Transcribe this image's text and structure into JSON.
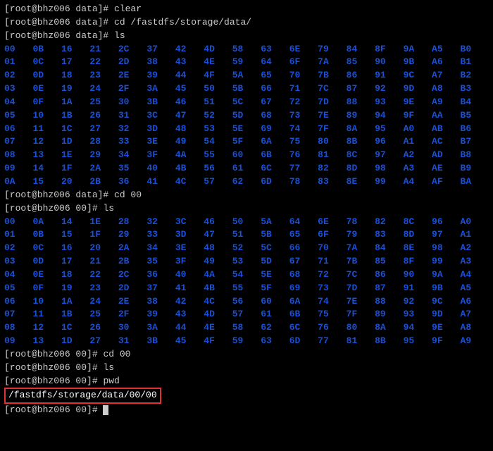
{
  "host": "bhz006",
  "user": "root",
  "lines": [
    {
      "dir": "data",
      "cmd": "clear"
    },
    {
      "dir": "data",
      "cmd": "cd /fastdfs/storage/data/"
    },
    {
      "dir": "data",
      "cmd": "ls"
    }
  ],
  "grid1": [
    [
      "00",
      "0B",
      "16",
      "21",
      "2C",
      "37",
      "42",
      "4D",
      "58",
      "63",
      "6E",
      "79",
      "84",
      "8F",
      "9A",
      "A5",
      "B0"
    ],
    [
      "01",
      "0C",
      "17",
      "22",
      "2D",
      "38",
      "43",
      "4E",
      "59",
      "64",
      "6F",
      "7A",
      "85",
      "90",
      "9B",
      "A6",
      "B1"
    ],
    [
      "02",
      "0D",
      "18",
      "23",
      "2E",
      "39",
      "44",
      "4F",
      "5A",
      "65",
      "70",
      "7B",
      "86",
      "91",
      "9C",
      "A7",
      "B2"
    ],
    [
      "03",
      "0E",
      "19",
      "24",
      "2F",
      "3A",
      "45",
      "50",
      "5B",
      "66",
      "71",
      "7C",
      "87",
      "92",
      "9D",
      "A8",
      "B3"
    ],
    [
      "04",
      "0F",
      "1A",
      "25",
      "30",
      "3B",
      "46",
      "51",
      "5C",
      "67",
      "72",
      "7D",
      "88",
      "93",
      "9E",
      "A9",
      "B4"
    ],
    [
      "05",
      "10",
      "1B",
      "26",
      "31",
      "3C",
      "47",
      "52",
      "5D",
      "68",
      "73",
      "7E",
      "89",
      "94",
      "9F",
      "AA",
      "B5"
    ],
    [
      "06",
      "11",
      "1C",
      "27",
      "32",
      "3D",
      "48",
      "53",
      "5E",
      "69",
      "74",
      "7F",
      "8A",
      "95",
      "A0",
      "AB",
      "B6"
    ],
    [
      "07",
      "12",
      "1D",
      "28",
      "33",
      "3E",
      "49",
      "54",
      "5F",
      "6A",
      "75",
      "80",
      "8B",
      "96",
      "A1",
      "AC",
      "B7"
    ],
    [
      "08",
      "13",
      "1E",
      "29",
      "34",
      "3F",
      "4A",
      "55",
      "60",
      "6B",
      "76",
      "81",
      "8C",
      "97",
      "A2",
      "AD",
      "B8"
    ],
    [
      "09",
      "14",
      "1F",
      "2A",
      "35",
      "40",
      "4B",
      "56",
      "61",
      "6C",
      "77",
      "82",
      "8D",
      "98",
      "A3",
      "AE",
      "B9"
    ],
    [
      "0A",
      "15",
      "20",
      "2B",
      "36",
      "41",
      "4C",
      "57",
      "62",
      "6D",
      "78",
      "83",
      "8E",
      "99",
      "A4",
      "AF",
      "BA"
    ]
  ],
  "lines2": [
    {
      "dir": "data",
      "cmd": "cd 00"
    },
    {
      "dir": "00",
      "cmd": "ls"
    }
  ],
  "grid2": [
    [
      "00",
      "0A",
      "14",
      "1E",
      "28",
      "32",
      "3C",
      "46",
      "50",
      "5A",
      "64",
      "6E",
      "78",
      "82",
      "8C",
      "96",
      "A0"
    ],
    [
      "01",
      "0B",
      "15",
      "1F",
      "29",
      "33",
      "3D",
      "47",
      "51",
      "5B",
      "65",
      "6F",
      "79",
      "83",
      "8D",
      "97",
      "A1"
    ],
    [
      "02",
      "0C",
      "16",
      "20",
      "2A",
      "34",
      "3E",
      "48",
      "52",
      "5C",
      "66",
      "70",
      "7A",
      "84",
      "8E",
      "98",
      "A2"
    ],
    [
      "03",
      "0D",
      "17",
      "21",
      "2B",
      "35",
      "3F",
      "49",
      "53",
      "5D",
      "67",
      "71",
      "7B",
      "85",
      "8F",
      "99",
      "A3"
    ],
    [
      "04",
      "0E",
      "18",
      "22",
      "2C",
      "36",
      "40",
      "4A",
      "54",
      "5E",
      "68",
      "72",
      "7C",
      "86",
      "90",
      "9A",
      "A4"
    ],
    [
      "05",
      "0F",
      "19",
      "23",
      "2D",
      "37",
      "41",
      "4B",
      "55",
      "5F",
      "69",
      "73",
      "7D",
      "87",
      "91",
      "9B",
      "A5"
    ],
    [
      "06",
      "10",
      "1A",
      "24",
      "2E",
      "38",
      "42",
      "4C",
      "56",
      "60",
      "6A",
      "74",
      "7E",
      "88",
      "92",
      "9C",
      "A6"
    ],
    [
      "07",
      "11",
      "1B",
      "25",
      "2F",
      "39",
      "43",
      "4D",
      "57",
      "61",
      "6B",
      "75",
      "7F",
      "89",
      "93",
      "9D",
      "A7"
    ],
    [
      "08",
      "12",
      "1C",
      "26",
      "30",
      "3A",
      "44",
      "4E",
      "58",
      "62",
      "6C",
      "76",
      "80",
      "8A",
      "94",
      "9E",
      "A8"
    ],
    [
      "09",
      "13",
      "1D",
      "27",
      "31",
      "3B",
      "45",
      "4F",
      "59",
      "63",
      "6D",
      "77",
      "81",
      "8B",
      "95",
      "9F",
      "A9"
    ]
  ],
  "lines3": [
    {
      "dir": "00",
      "cmd": "cd 00"
    },
    {
      "dir": "00",
      "cmd": "ls"
    },
    {
      "dir": "00",
      "cmd": "pwd"
    }
  ],
  "pwd_output": "/fastdfs/storage/data/00/00",
  "final_prompt_dir": "00"
}
